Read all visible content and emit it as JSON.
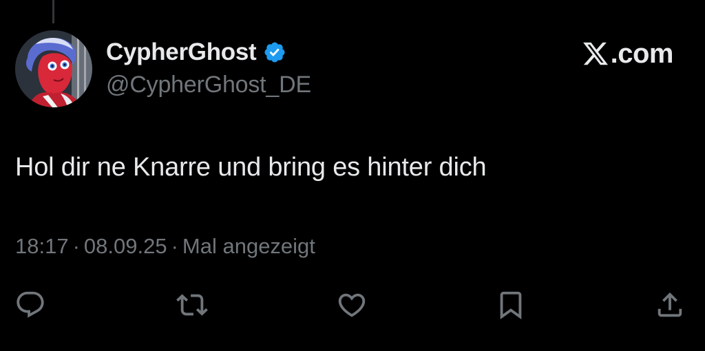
{
  "tweet": {
    "author": {
      "display_name": "CypherGhost",
      "handle": "@CypherGhost_DE",
      "verified": true
    },
    "brand": {
      "logo_icon": "x-logo-icon",
      "text": ".com"
    },
    "text": "Hol dir ne Knarre und bring es hinter dich",
    "meta": {
      "time": "18:17",
      "separator": "·",
      "date": "08.09.25",
      "views": "Mal angezeigt"
    },
    "actions": [
      {
        "icon": "reply-icon"
      },
      {
        "icon": "retweet-icon"
      },
      {
        "icon": "like-icon"
      },
      {
        "icon": "bookmark-icon"
      },
      {
        "icon": "share-icon"
      }
    ]
  },
  "colors": {
    "background": "#000000",
    "primary_text": "#e7e9ea",
    "secondary_text": "#71767b",
    "verified_badge": "#1d9bf0"
  }
}
